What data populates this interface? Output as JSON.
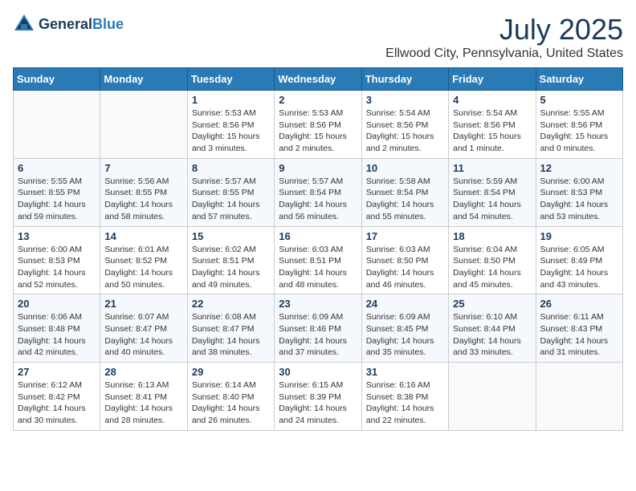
{
  "header": {
    "logo_general": "General",
    "logo_blue": "Blue",
    "month": "July 2025",
    "location": "Ellwood City, Pennsylvania, United States"
  },
  "weekdays": [
    "Sunday",
    "Monday",
    "Tuesday",
    "Wednesday",
    "Thursday",
    "Friday",
    "Saturday"
  ],
  "weeks": [
    [
      {
        "day": "",
        "empty": true
      },
      {
        "day": "",
        "empty": true
      },
      {
        "day": "1",
        "sunrise": "Sunrise: 5:53 AM",
        "sunset": "Sunset: 8:56 PM",
        "daylight": "Daylight: 15 hours and 3 minutes."
      },
      {
        "day": "2",
        "sunrise": "Sunrise: 5:53 AM",
        "sunset": "Sunset: 8:56 PM",
        "daylight": "Daylight: 15 hours and 2 minutes."
      },
      {
        "day": "3",
        "sunrise": "Sunrise: 5:54 AM",
        "sunset": "Sunset: 8:56 PM",
        "daylight": "Daylight: 15 hours and 2 minutes."
      },
      {
        "day": "4",
        "sunrise": "Sunrise: 5:54 AM",
        "sunset": "Sunset: 8:56 PM",
        "daylight": "Daylight: 15 hours and 1 minute."
      },
      {
        "day": "5",
        "sunrise": "Sunrise: 5:55 AM",
        "sunset": "Sunset: 8:56 PM",
        "daylight": "Daylight: 15 hours and 0 minutes."
      }
    ],
    [
      {
        "day": "6",
        "sunrise": "Sunrise: 5:55 AM",
        "sunset": "Sunset: 8:55 PM",
        "daylight": "Daylight: 14 hours and 59 minutes."
      },
      {
        "day": "7",
        "sunrise": "Sunrise: 5:56 AM",
        "sunset": "Sunset: 8:55 PM",
        "daylight": "Daylight: 14 hours and 58 minutes."
      },
      {
        "day": "8",
        "sunrise": "Sunrise: 5:57 AM",
        "sunset": "Sunset: 8:55 PM",
        "daylight": "Daylight: 14 hours and 57 minutes."
      },
      {
        "day": "9",
        "sunrise": "Sunrise: 5:57 AM",
        "sunset": "Sunset: 8:54 PM",
        "daylight": "Daylight: 14 hours and 56 minutes."
      },
      {
        "day": "10",
        "sunrise": "Sunrise: 5:58 AM",
        "sunset": "Sunset: 8:54 PM",
        "daylight": "Daylight: 14 hours and 55 minutes."
      },
      {
        "day": "11",
        "sunrise": "Sunrise: 5:59 AM",
        "sunset": "Sunset: 8:54 PM",
        "daylight": "Daylight: 14 hours and 54 minutes."
      },
      {
        "day": "12",
        "sunrise": "Sunrise: 6:00 AM",
        "sunset": "Sunset: 8:53 PM",
        "daylight": "Daylight: 14 hours and 53 minutes."
      }
    ],
    [
      {
        "day": "13",
        "sunrise": "Sunrise: 6:00 AM",
        "sunset": "Sunset: 8:53 PM",
        "daylight": "Daylight: 14 hours and 52 minutes."
      },
      {
        "day": "14",
        "sunrise": "Sunrise: 6:01 AM",
        "sunset": "Sunset: 8:52 PM",
        "daylight": "Daylight: 14 hours and 50 minutes."
      },
      {
        "day": "15",
        "sunrise": "Sunrise: 6:02 AM",
        "sunset": "Sunset: 8:51 PM",
        "daylight": "Daylight: 14 hours and 49 minutes."
      },
      {
        "day": "16",
        "sunrise": "Sunrise: 6:03 AM",
        "sunset": "Sunset: 8:51 PM",
        "daylight": "Daylight: 14 hours and 48 minutes."
      },
      {
        "day": "17",
        "sunrise": "Sunrise: 6:03 AM",
        "sunset": "Sunset: 8:50 PM",
        "daylight": "Daylight: 14 hours and 46 minutes."
      },
      {
        "day": "18",
        "sunrise": "Sunrise: 6:04 AM",
        "sunset": "Sunset: 8:50 PM",
        "daylight": "Daylight: 14 hours and 45 minutes."
      },
      {
        "day": "19",
        "sunrise": "Sunrise: 6:05 AM",
        "sunset": "Sunset: 8:49 PM",
        "daylight": "Daylight: 14 hours and 43 minutes."
      }
    ],
    [
      {
        "day": "20",
        "sunrise": "Sunrise: 6:06 AM",
        "sunset": "Sunset: 8:48 PM",
        "daylight": "Daylight: 14 hours and 42 minutes."
      },
      {
        "day": "21",
        "sunrise": "Sunrise: 6:07 AM",
        "sunset": "Sunset: 8:47 PM",
        "daylight": "Daylight: 14 hours and 40 minutes."
      },
      {
        "day": "22",
        "sunrise": "Sunrise: 6:08 AM",
        "sunset": "Sunset: 8:47 PM",
        "daylight": "Daylight: 14 hours and 38 minutes."
      },
      {
        "day": "23",
        "sunrise": "Sunrise: 6:09 AM",
        "sunset": "Sunset: 8:46 PM",
        "daylight": "Daylight: 14 hours and 37 minutes."
      },
      {
        "day": "24",
        "sunrise": "Sunrise: 6:09 AM",
        "sunset": "Sunset: 8:45 PM",
        "daylight": "Daylight: 14 hours and 35 minutes."
      },
      {
        "day": "25",
        "sunrise": "Sunrise: 6:10 AM",
        "sunset": "Sunset: 8:44 PM",
        "daylight": "Daylight: 14 hours and 33 minutes."
      },
      {
        "day": "26",
        "sunrise": "Sunrise: 6:11 AM",
        "sunset": "Sunset: 8:43 PM",
        "daylight": "Daylight: 14 hours and 31 minutes."
      }
    ],
    [
      {
        "day": "27",
        "sunrise": "Sunrise: 6:12 AM",
        "sunset": "Sunset: 8:42 PM",
        "daylight": "Daylight: 14 hours and 30 minutes."
      },
      {
        "day": "28",
        "sunrise": "Sunrise: 6:13 AM",
        "sunset": "Sunset: 8:41 PM",
        "daylight": "Daylight: 14 hours and 28 minutes."
      },
      {
        "day": "29",
        "sunrise": "Sunrise: 6:14 AM",
        "sunset": "Sunset: 8:40 PM",
        "daylight": "Daylight: 14 hours and 26 minutes."
      },
      {
        "day": "30",
        "sunrise": "Sunrise: 6:15 AM",
        "sunset": "Sunset: 8:39 PM",
        "daylight": "Daylight: 14 hours and 24 minutes."
      },
      {
        "day": "31",
        "sunrise": "Sunrise: 6:16 AM",
        "sunset": "Sunset: 8:38 PM",
        "daylight": "Daylight: 14 hours and 22 minutes."
      },
      {
        "day": "",
        "empty": true
      },
      {
        "day": "",
        "empty": true
      }
    ]
  ]
}
